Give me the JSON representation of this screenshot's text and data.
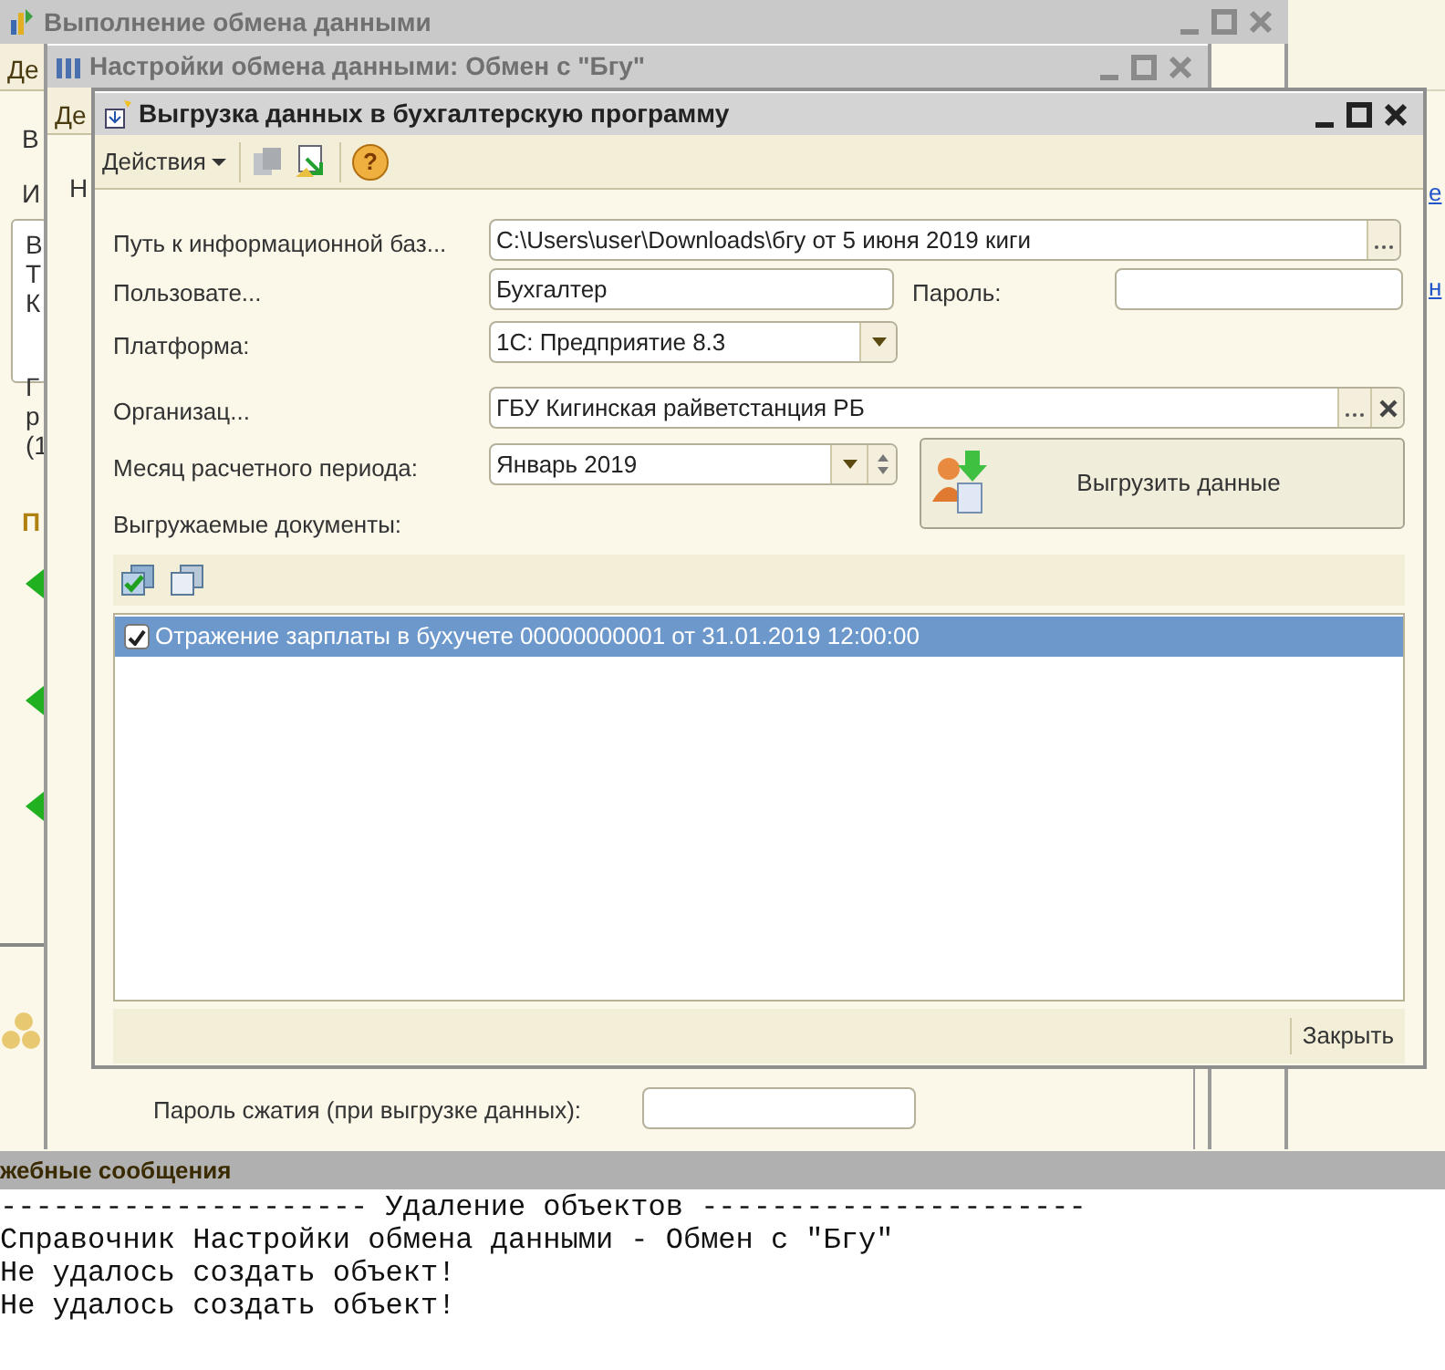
{
  "outer_window": {
    "title": "Выполнение обмена данными",
    "fragments": [
      {
        "text": "Де",
        "kind": "tab"
      },
      {
        "text": "В",
        "kind": "plain"
      },
      {
        "text": "И",
        "kind": "plain"
      },
      {
        "text": "В",
        "kind": "plain"
      },
      {
        "text": "Т",
        "kind": "plain"
      },
      {
        "text": "К",
        "kind": "plain"
      },
      {
        "text": "Г",
        "kind": "plain"
      },
      {
        "text": "р",
        "kind": "plain"
      },
      {
        "text": "(1",
        "kind": "plain"
      },
      {
        "text": "П",
        "kind": "heading"
      }
    ]
  },
  "side_links": [
    "е",
    "н"
  ],
  "settings_window": {
    "title": "Настройки обмена данными: Обмен с \"Бгу\"",
    "fragments": [
      {
        "text": "Де",
        "kind": "tab"
      },
      {
        "text": "Н",
        "kind": "plain"
      }
    ],
    "compression_password": {
      "label": "Пароль сжатия (при выгрузке данных):"
    }
  },
  "dialog": {
    "title": "Выгрузка данных в бухгалтерскую программу",
    "toolbar": {
      "actions": "Действия",
      "help": "?"
    },
    "fields": [
      {
        "label": "Путь к информационной баз...",
        "value": "C:\\Users\\user\\Downloads\\бгу от 5 июня 2019 киги",
        "kind": "browse"
      },
      {
        "label": "Пользовате...",
        "value": "Бухгалтер",
        "kind": "text"
      },
      {
        "label": "Пароль:",
        "kind": "password"
      },
      {
        "label": "Платформа:",
        "value": "1С: Предприятие 8.3",
        "kind": "dropdown"
      },
      {
        "label": "Организац...",
        "value": "ГБУ Кигинская райветстанция РБ",
        "kind": "browse_clear"
      },
      {
        "label": "Месяц расчетного периода:",
        "value": "Январь 2019",
        "kind": "dropdown_spin"
      }
    ],
    "export_button": "Выгрузить данные",
    "documents_label": "Выгружаемые документы:",
    "documents": [
      {
        "text": "Отражение зарплаты в бухучете 00000000001 от 31.01.2019 12:00:00",
        "checked": true,
        "selected": true
      }
    ],
    "close_button": "Закрыть"
  },
  "messages": {
    "title": "жебные сообщения",
    "lines": [
      "--------------------- Удаление объектов ----------------------",
      "Справочник Настройки обмена данными - Обмен с \"Бгу\"",
      "Не удалось создать объект!",
      "Не удалось создать объект!"
    ]
  }
}
